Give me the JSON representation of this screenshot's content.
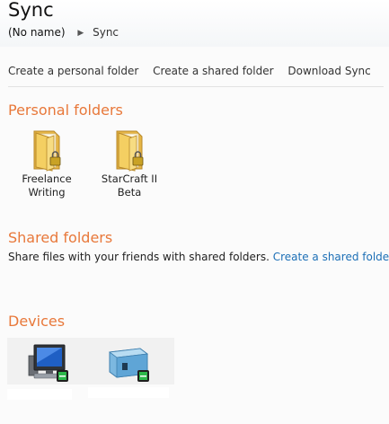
{
  "header": {
    "title": "Sync",
    "breadcrumb_root": "(No name)",
    "breadcrumb_current": "Sync"
  },
  "actions": {
    "create_personal": "Create a personal folder",
    "create_shared": "Create a shared folder",
    "download": "Download Sync"
  },
  "personal": {
    "title": "Personal folders",
    "folders": [
      {
        "line1": "Freelance",
        "line2": "Writing",
        "icon": "locked-folder-icon"
      },
      {
        "line1": "StarCraft II",
        "line2": "Beta",
        "icon": "locked-folder-icon"
      }
    ]
  },
  "shared": {
    "title": "Shared folders",
    "description": "Share files with your friends with shared folders.",
    "link": "Create a shared folder"
  },
  "devices": {
    "title": "Devices",
    "items": [
      {
        "icon": "desktop-computer-icon",
        "status": "online"
      },
      {
        "icon": "server-device-icon",
        "status": "online"
      }
    ]
  },
  "colors": {
    "section_title": "#e8783a",
    "link": "#1c6fb6",
    "online_badge": "#2db84a",
    "folder": "#f2c94c"
  }
}
